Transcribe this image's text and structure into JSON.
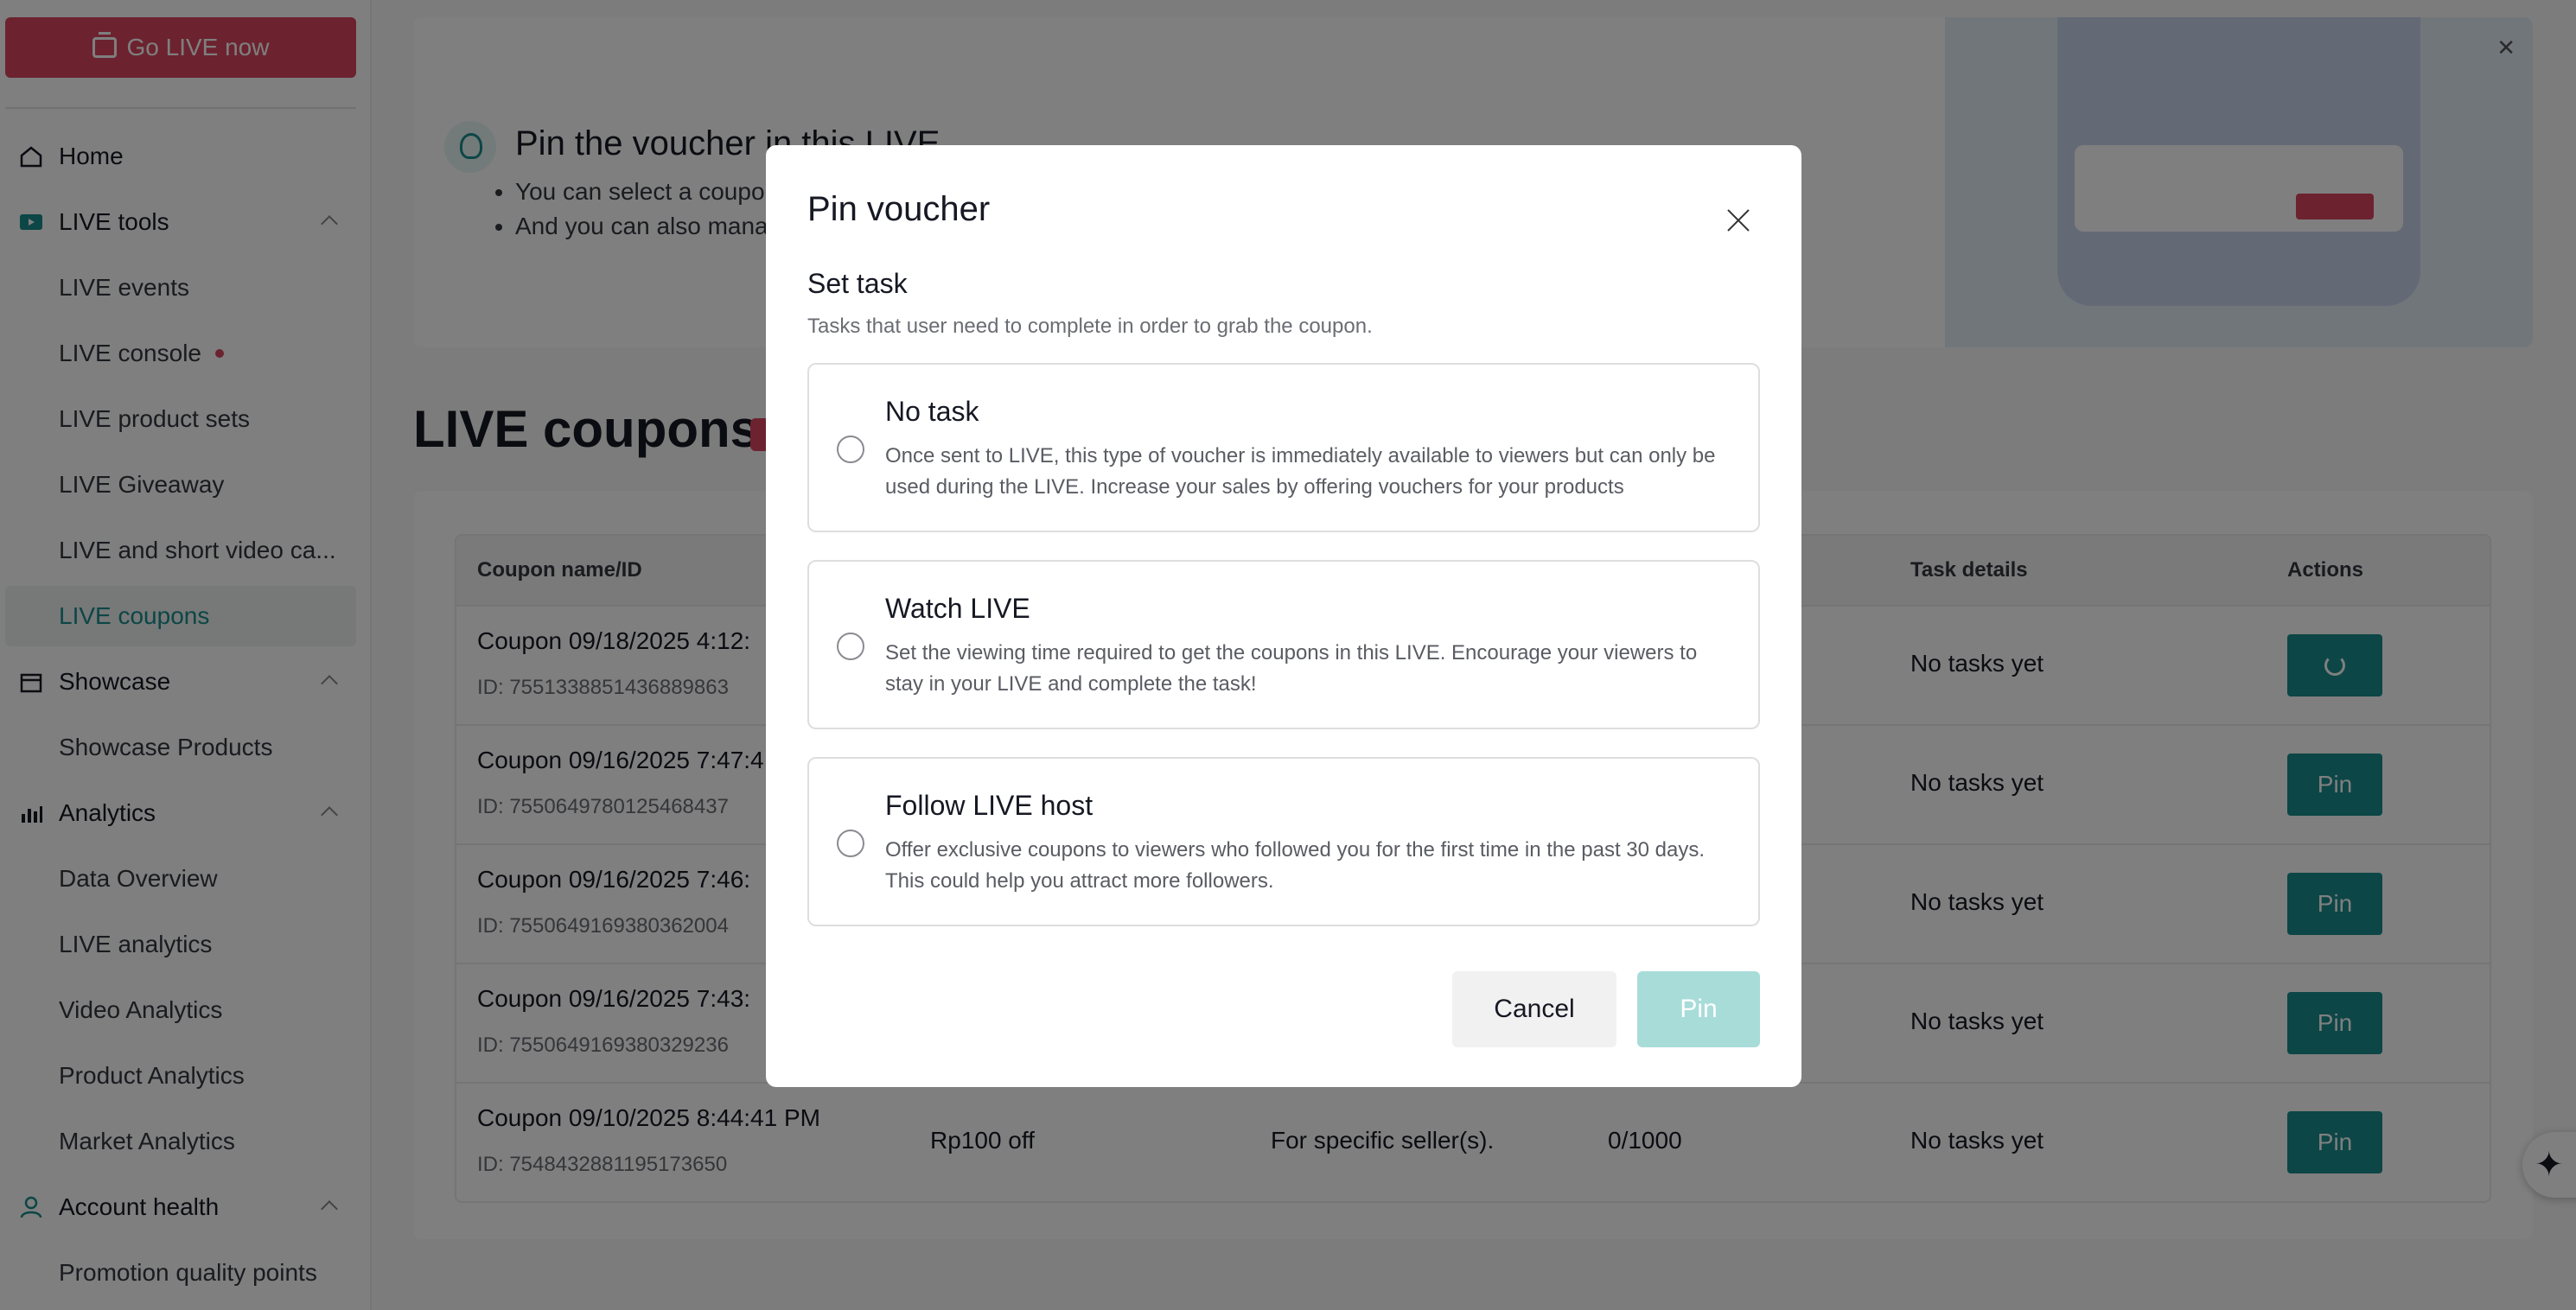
{
  "sidebar": {
    "go_live": "Go LIVE now",
    "items": [
      {
        "label": "Home"
      },
      {
        "label": "LIVE tools"
      },
      {
        "label": "LIVE events"
      },
      {
        "label": "LIVE console"
      },
      {
        "label": "LIVE product sets"
      },
      {
        "label": "LIVE Giveaway"
      },
      {
        "label": "LIVE and short video ca..."
      },
      {
        "label": "LIVE coupons"
      },
      {
        "label": "Showcase"
      },
      {
        "label": "Showcase Products"
      },
      {
        "label": "Analytics"
      },
      {
        "label": "Data Overview"
      },
      {
        "label": "LIVE analytics"
      },
      {
        "label": "Video Analytics"
      },
      {
        "label": "Product Analytics"
      },
      {
        "label": "Market Analytics"
      },
      {
        "label": "Account health"
      },
      {
        "label": "Promotion quality points"
      }
    ]
  },
  "banner": {
    "title": "Pin the voucher in this LIVE",
    "bullets": [
      "You can select a coupo",
      "And you can also mana"
    ]
  },
  "page": {
    "title": "LIVE coupons"
  },
  "table": {
    "headers": {
      "name": "Coupon name/ID",
      "task": "Task details",
      "actions": "Actions"
    },
    "rows": [
      {
        "name": "Coupon 09/18/2025 4:12:",
        "id": "ID: 7551338851436889863",
        "discount": "",
        "type": "",
        "qty": "",
        "task": "No tasks yet",
        "action": ""
      },
      {
        "name": "Coupon 09/16/2025 7:47:4",
        "id": "ID: 7550649780125468437",
        "discount": "",
        "type": "",
        "qty": "",
        "task": "No tasks yet",
        "action": "Pin"
      },
      {
        "name": "Coupon 09/16/2025 7:46:",
        "id": "ID: 7550649169380362004",
        "discount": "",
        "type": "",
        "qty": "",
        "task": "No tasks yet",
        "action": "Pin"
      },
      {
        "name": "Coupon 09/16/2025 7:43:",
        "id": "ID: 7550649169380329236",
        "discount": "",
        "type": "",
        "qty": "",
        "task": "No tasks yet",
        "action": "Pin"
      },
      {
        "name": "Coupon 09/10/2025 8:44:41 PM",
        "id": "ID: 7548432881195173650",
        "discount": "Rp100 off",
        "type": "For specific seller(s).",
        "qty": "0/1000",
        "task": "No tasks yet",
        "action": "Pin"
      }
    ]
  },
  "modal": {
    "title": "Pin voucher",
    "section_title": "Set task",
    "section_desc": "Tasks that user need to complete in order to grab the coupon.",
    "options": [
      {
        "title": "No task",
        "desc": "Once sent to LIVE, this type of voucher is immediately available to viewers but can only be used during the LIVE. Increase your sales by offering vouchers for your products"
      },
      {
        "title": "Watch LIVE",
        "desc": "Set the viewing time required to get the coupons in this LIVE. Encourage your viewers to stay in your LIVE and complete the task!"
      },
      {
        "title": "Follow LIVE host",
        "desc": "Offer exclusive coupons to viewers who followed you for the first time in the past 30 days. This could help you attract more followers."
      }
    ],
    "cancel": "Cancel",
    "pin": "Pin"
  },
  "colors": {
    "accent": "#1a8c8c",
    "brand_red": "#d9465f",
    "pin_disabled": "#a8dcd9"
  }
}
